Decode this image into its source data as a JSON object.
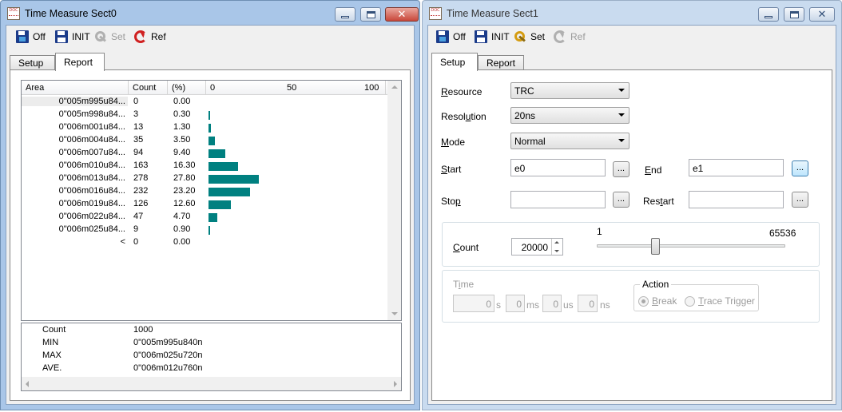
{
  "window0": {
    "title": "Time Measure Sect0",
    "toolbar": {
      "off": "Off",
      "init": "INIT",
      "set": "Set",
      "ref": "Ref"
    },
    "tabs": [
      "Setup",
      "Report"
    ],
    "active_tab": "Report",
    "report": {
      "columns": [
        "Area",
        "Count",
        "(%)",
        "0",
        "50",
        "100"
      ],
      "rows": [
        {
          "area": "0\"005m995u84...",
          "count": "0",
          "pct": "0.00",
          "percent": 0.0
        },
        {
          "area": "0\"005m998u84...",
          "count": "3",
          "pct": "0.30",
          "percent": 0.3
        },
        {
          "area": "0\"006m001u84...",
          "count": "13",
          "pct": "1.30",
          "percent": 1.3
        },
        {
          "area": "0\"006m004u84...",
          "count": "35",
          "pct": "3.50",
          "percent": 3.5
        },
        {
          "area": "0\"006m007u84...",
          "count": "94",
          "pct": "9.40",
          "percent": 9.4
        },
        {
          "area": "0\"006m010u84...",
          "count": "163",
          "pct": "16.30",
          "percent": 16.3
        },
        {
          "area": "0\"006m013u84...",
          "count": "278",
          "pct": "27.80",
          "percent": 27.8
        },
        {
          "area": "0\"006m016u84...",
          "count": "232",
          "pct": "23.20",
          "percent": 23.2
        },
        {
          "area": "0\"006m019u84...",
          "count": "126",
          "pct": "12.60",
          "percent": 12.6
        },
        {
          "area": "0\"006m022u84...",
          "count": "47",
          "pct": "4.70",
          "percent": 4.7
        },
        {
          "area": "0\"006m025u84...",
          "count": "9",
          "pct": "0.90",
          "percent": 0.9
        },
        {
          "area": "<",
          "count": "0",
          "pct": "0.00",
          "percent": 0.0
        }
      ],
      "summary": [
        {
          "label": "Count",
          "value": "1000"
        },
        {
          "label": "MIN",
          "value": "0\"005m995u840n"
        },
        {
          "label": "MAX",
          "value": "0\"006m025u720n"
        },
        {
          "label": "AVE.",
          "value": "0\"006m012u760n"
        }
      ],
      "bar_color": "#008080"
    }
  },
  "window1": {
    "title": "Time Measure Sect1",
    "toolbar": {
      "off": "Off",
      "init": "INIT",
      "set": "Set",
      "ref": "Ref"
    },
    "tabs": [
      "Setup",
      "Report"
    ],
    "active_tab": "Setup",
    "setup": {
      "resource": {
        "label_pre": "",
        "label_u": "R",
        "label_post": "esource",
        "value": "TRC"
      },
      "resolution": {
        "label_pre": "Resol",
        "label_u": "u",
        "label_post": "tion",
        "value": "20ns"
      },
      "mode": {
        "label_pre": "",
        "label_u": "M",
        "label_post": "ode",
        "value": "Normal"
      },
      "start": {
        "label_pre": "",
        "label_u": "S",
        "label_post": "tart",
        "value": "e0",
        "button": "..."
      },
      "end": {
        "label_pre": "",
        "label_u": "E",
        "label_post": "nd",
        "value": "e1",
        "button": "..."
      },
      "stop": {
        "label_pre": "Sto",
        "label_u": "p",
        "label_post": "",
        "value": "",
        "button": "..."
      },
      "restart": {
        "label_pre": "Res",
        "label_u": "t",
        "label_post": "art",
        "value": "",
        "button": "..."
      },
      "count": {
        "label_pre": "",
        "label_u": "C",
        "label_post": "ount",
        "value": "20000",
        "slider_min": "1",
        "slider_max": "65536",
        "slider_fraction": 0.31
      },
      "time": {
        "label_pre": "T",
        "label_u": "i",
        "label_post": "me",
        "s_value": "0",
        "s_unit": "s",
        "ms_value": "0",
        "ms_unit": "ms",
        "us_value": "0",
        "us_unit": "us",
        "ns_value": "0",
        "ns_unit": "ns"
      },
      "action": {
        "label": "Action",
        "break_pre": "",
        "break_u": "B",
        "break_post": "reak",
        "trace_pre": "",
        "trace_u": "T",
        "trace_post": "race Trigger",
        "selected": "Break"
      }
    }
  }
}
